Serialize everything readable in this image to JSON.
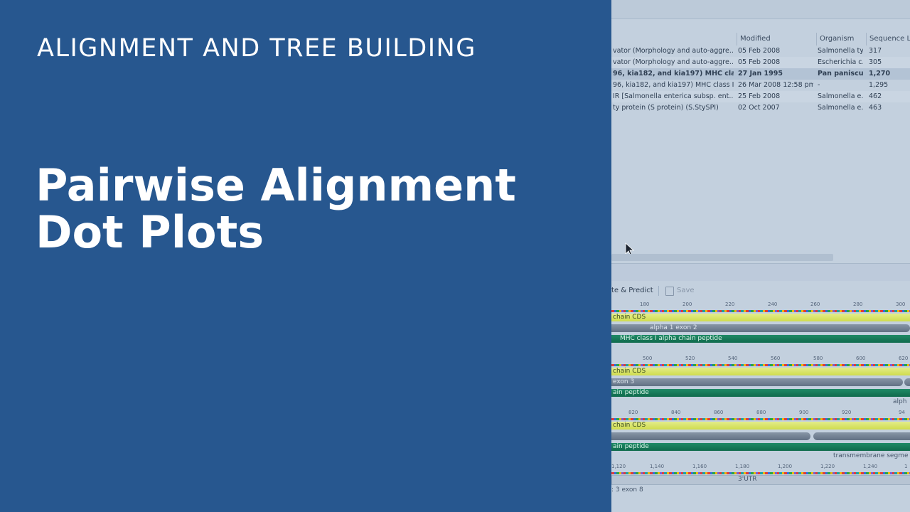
{
  "slide": {
    "kicker": "ALIGNMENT AND TREE BUILDING",
    "title_line1": "Pairwise Alignment",
    "title_line2": "Dot Plots",
    "bg_color": "#27578f"
  },
  "table": {
    "headers": {
      "modified": "Modified",
      "organism": "Organism",
      "sequence": "Sequence L..."
    },
    "rows": [
      {
        "name": "vator (Morphology and auto-aggre...",
        "modified": "05 Feb 2008",
        "organism": "Salmonella ty...",
        "length": "317"
      },
      {
        "name": "vator (Morphology and auto-aggre...",
        "modified": "05 Feb 2008",
        "organism": "Escherichia c...",
        "length": "305"
      },
      {
        "name": "96, kia182, and kia197) MHC class I...",
        "modified": "27 Jan 1995",
        "organism": "Pan paniscus",
        "length": "1,270"
      },
      {
        "name": "96, kia182, and kia197) MHC class I...",
        "modified": "26 Mar 2008 12:58 pm",
        "organism": "-",
        "length": "1,295"
      },
      {
        "name": "IR [Salmonella enterica subsp. ent...",
        "modified": "25 Feb 2008",
        "organism": "Salmonella e...",
        "length": "462"
      },
      {
        "name": "ty protein (S protein) (S.StySPI)",
        "modified": "02 Oct 2007",
        "organism": "Salmonella e...",
        "length": "463"
      }
    ]
  },
  "toolbar": {
    "predict": "te & Predict",
    "save": "Save"
  },
  "tracks": {
    "ruler1": [
      "180",
      "200",
      "220",
      "240",
      "260",
      "280",
      "300"
    ],
    "ruler2": [
      "500",
      "520",
      "540",
      "560",
      "580",
      "600",
      "620"
    ],
    "ruler3": [
      "820",
      "840",
      "860",
      "880",
      "900",
      "920",
      "94"
    ],
    "ruler4": [
      "1,120",
      "1,140",
      "1,160",
      "1,180",
      "1,200",
      "1,220",
      "1,240",
      "1"
    ],
    "cds1": "chain CDS",
    "exon1": "alpha 1 exon 2",
    "pep1": "MHC class I alpha chain peptide",
    "cds2": "chain CDS",
    "exon2": "exon 3",
    "pep2": "ain peptide",
    "alph": "alph",
    "cds3": "chain CDS",
    "pep3": "ain peptide",
    "tm": "transmembrane segme",
    "utr": "3'UTR",
    "exon8": ": 3 exon 8"
  }
}
